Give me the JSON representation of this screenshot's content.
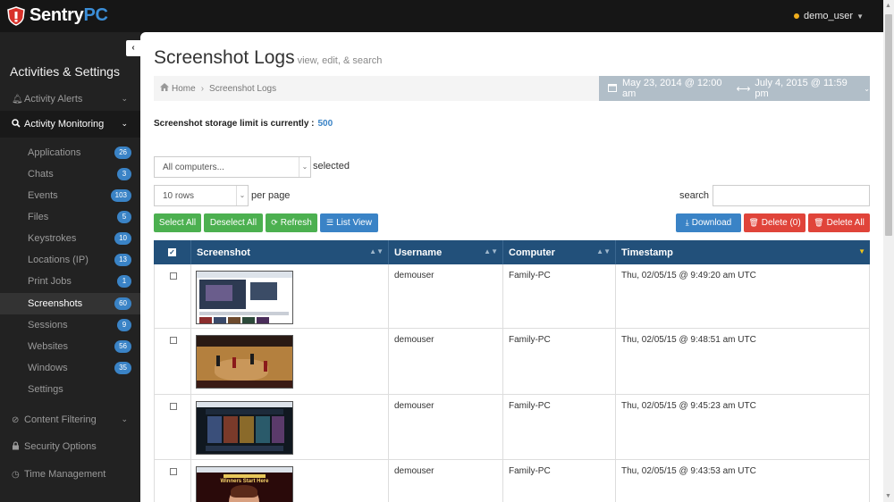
{
  "brand": {
    "name_a": "Sentry",
    "name_b": "PC"
  },
  "user": {
    "name": "demo_user"
  },
  "sidebar": {
    "heading": "Activities & Settings",
    "activity_alerts": "Activity Alerts",
    "activity_monitoring": "Activity Monitoring",
    "items": [
      {
        "label": "Applications",
        "count": "26"
      },
      {
        "label": "Chats",
        "count": "3"
      },
      {
        "label": "Events",
        "count": "103"
      },
      {
        "label": "Files",
        "count": "5"
      },
      {
        "label": "Keystrokes",
        "count": "10"
      },
      {
        "label": "Locations (IP)",
        "count": "13"
      },
      {
        "label": "Print Jobs",
        "count": "1"
      },
      {
        "label": "Screenshots",
        "count": "60"
      },
      {
        "label": "Sessions",
        "count": "9"
      },
      {
        "label": "Websites",
        "count": "56"
      },
      {
        "label": "Windows",
        "count": "35"
      },
      {
        "label": "Settings",
        "count": ""
      }
    ],
    "content_filtering": "Content Filtering",
    "security_options": "Security Options",
    "time_management": "Time Management"
  },
  "page": {
    "title": "Screenshot Logs",
    "subtitle": "view, edit, & search",
    "breadcrumb_home": "Home",
    "breadcrumb_current": "Screenshot Logs",
    "date_from": "May 23, 2014 @ 12:00 am",
    "date_to": "July 4, 2015 @ 11:59 pm",
    "storage_label": "Screenshot storage limit is currently :",
    "storage_value": "500"
  },
  "controls": {
    "computer_select": "All computers...",
    "selected_label": "selected",
    "rows_select": "10 rows",
    "per_page_label": "per page",
    "search_label": "search"
  },
  "buttons": {
    "select_all": "Select All",
    "deselect_all": "Deselect All",
    "refresh": "Refresh",
    "list_view": "List View",
    "download": "Download",
    "delete": "Delete (0)",
    "delete_all": "Delete All"
  },
  "table": {
    "columns": [
      "Screenshot",
      "Username",
      "Computer",
      "Timestamp"
    ],
    "rows": [
      {
        "username": "demouser",
        "computer": "Family-PC",
        "timestamp": "Thu, 02/05/15 @ 9:49:20 am UTC"
      },
      {
        "username": "demouser",
        "computer": "Family-PC",
        "timestamp": "Thu, 02/05/15 @ 9:48:51 am UTC"
      },
      {
        "username": "demouser",
        "computer": "Family-PC",
        "timestamp": "Thu, 02/05/15 @ 9:45:23 am UTC"
      },
      {
        "username": "demouser",
        "computer": "Family-PC",
        "timestamp": "Thu, 02/05/15 @ 9:43:53 am UTC"
      }
    ],
    "thumbnail_text_4": "Winners Start Here"
  },
  "colors": {
    "accent": "#3a83c6",
    "header": "#22507a",
    "green": "#4cb050",
    "red": "#e0443a"
  }
}
